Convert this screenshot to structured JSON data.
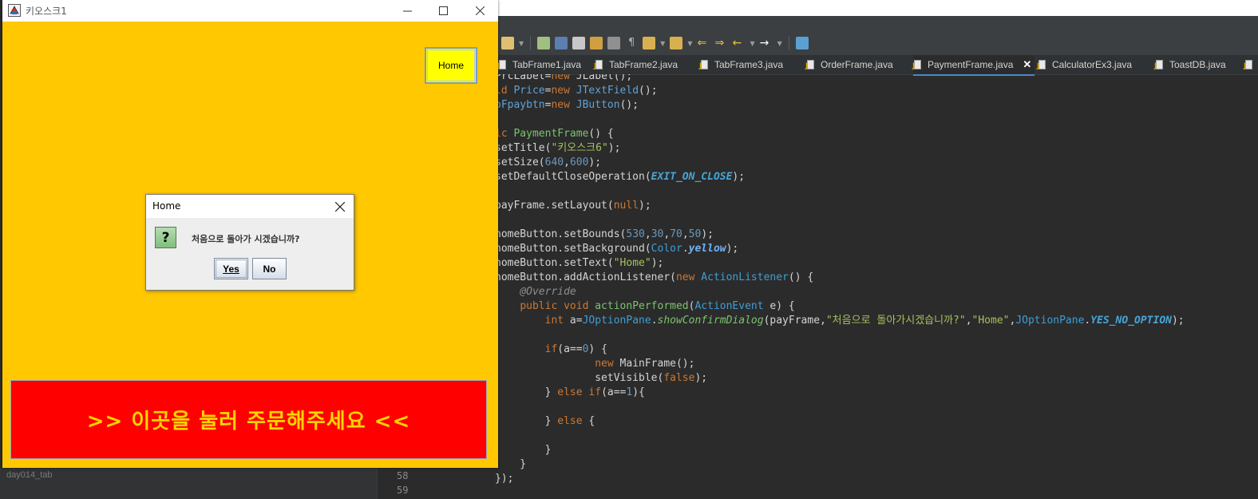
{
  "kiosk_window": {
    "title": "키오스크1",
    "home_button": "Home",
    "order_button": ">> 이곳을 눌러 주문해주세요 <<",
    "background_color": "#ffc800"
  },
  "dialog": {
    "title": "Home",
    "message": "처음으로 돌아가 시겠습니까?",
    "yes_label": "Yes",
    "no_label": "No",
    "icon": "question-icon"
  },
  "ide": {
    "tabs": [
      {
        "label": "TabFrame1.java",
        "active": false
      },
      {
        "label": "TabFrame2.java",
        "active": false
      },
      {
        "label": "TabFrame3.java",
        "active": false
      },
      {
        "label": "OrderFrame.java",
        "active": false
      },
      {
        "label": "PaymentFrame.java",
        "active": true
      },
      {
        "label": "CalculatorEx3.java",
        "active": false
      },
      {
        "label": "ToastDB.java",
        "active": false
      }
    ],
    "line_numbers": [
      "58",
      "59"
    ],
    "project_item": "day014_tab"
  }
}
